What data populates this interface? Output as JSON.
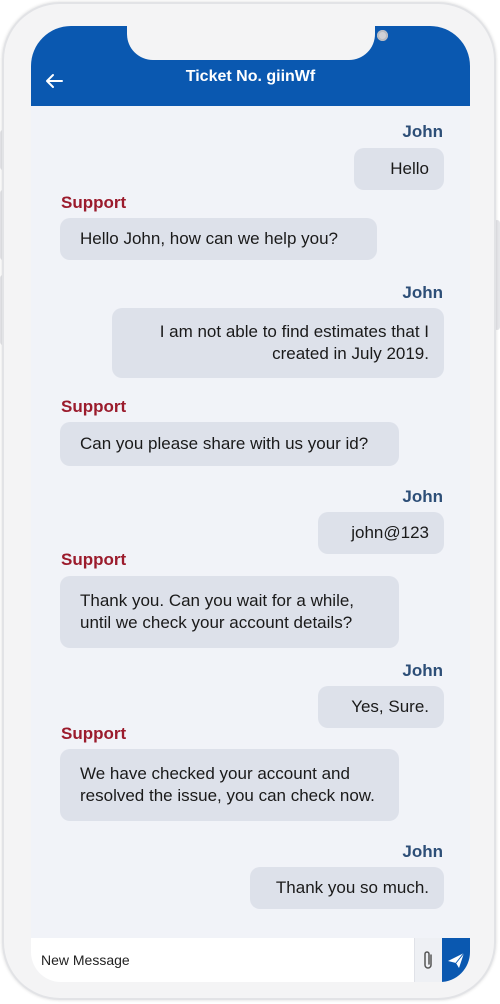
{
  "header": {
    "title": "Ticket No. giinWf",
    "back_icon": "arrow-left-icon"
  },
  "colors": {
    "header_bg": "#0a58b0",
    "user_name": "#2d4e77",
    "support_name": "#9b1b2c",
    "bubble_bg": "#dde1ea",
    "chat_bg": "#f1f3f8"
  },
  "messages": [
    {
      "sender": "John",
      "role": "user",
      "lines": [
        "Hello"
      ]
    },
    {
      "sender": "Support",
      "role": "support",
      "lines": [
        "Hello John, how can we help you?"
      ]
    },
    {
      "sender": "John",
      "role": "user",
      "lines": [
        "I am not able to find estimates that I",
        "created in July 2019."
      ]
    },
    {
      "sender": "Support",
      "role": "support",
      "lines": [
        "Can you please share with us your id?"
      ]
    },
    {
      "sender": "John",
      "role": "user",
      "lines": [
        "john@123"
      ]
    },
    {
      "sender": "Support",
      "role": "support",
      "lines": [
        "Thank you. Can you wait for a while,",
        "until we check your account details?"
      ]
    },
    {
      "sender": "John",
      "role": "user",
      "lines": [
        "Yes, Sure."
      ]
    },
    {
      "sender": "Support",
      "role": "support",
      "lines": [
        "We have checked your account and",
        "resolved the issue, you can check now."
      ]
    },
    {
      "sender": "John",
      "role": "user",
      "lines": [
        "Thank you so much."
      ]
    }
  ],
  "composer": {
    "placeholder": "New Message",
    "attach_icon": "paperclip-icon",
    "send_icon": "send-icon"
  }
}
